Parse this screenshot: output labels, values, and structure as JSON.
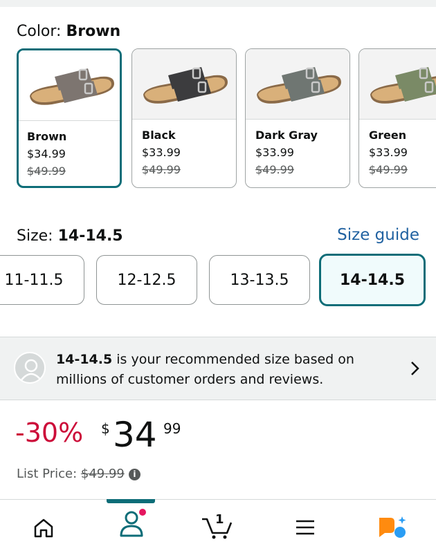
{
  "color": {
    "label": "Color: ",
    "selected": "Brown",
    "options": [
      {
        "name": "Brown",
        "price": "$34.99",
        "list_price": "$49.99",
        "strap": "#7d7570",
        "selected": true
      },
      {
        "name": "Black",
        "price": "$33.99",
        "list_price": "$49.99",
        "strap": "#3c3c3e",
        "selected": false
      },
      {
        "name": "Dark Gray",
        "price": "$33.99",
        "list_price": "$49.99",
        "strap": "#6f7672",
        "selected": false
      },
      {
        "name": "Green",
        "price": "$33.99",
        "list_price": "$49.99",
        "strap": "#7a8a66",
        "selected": false
      }
    ]
  },
  "size": {
    "label": "Size: ",
    "selected": "14-14.5",
    "guide_label": "Size guide",
    "options": [
      "11-11.5",
      "12-12.5",
      "13-13.5",
      "14-14.5"
    ]
  },
  "recommendation": {
    "size": "14-14.5",
    "text": " is your recommended size based on millions of customer orders and reviews."
  },
  "pricing": {
    "discount": "-30%",
    "currency": "$",
    "whole": "34",
    "fraction": "99",
    "list_label": "List Price: ",
    "list_value": "$49.99"
  },
  "nav": {
    "tabs": [
      "home-icon",
      "account-icon",
      "cart-icon",
      "menu-icon",
      "assistant-icon"
    ],
    "cart_count": "1",
    "active": "account-icon"
  },
  "colors": {
    "accent": "#0e6d78",
    "discount": "#cc0c39",
    "link": "#2162a1",
    "badge": "#e5165f",
    "assistant_orange": "#ff8b0f",
    "assistant_blue": "#2a9df4"
  }
}
